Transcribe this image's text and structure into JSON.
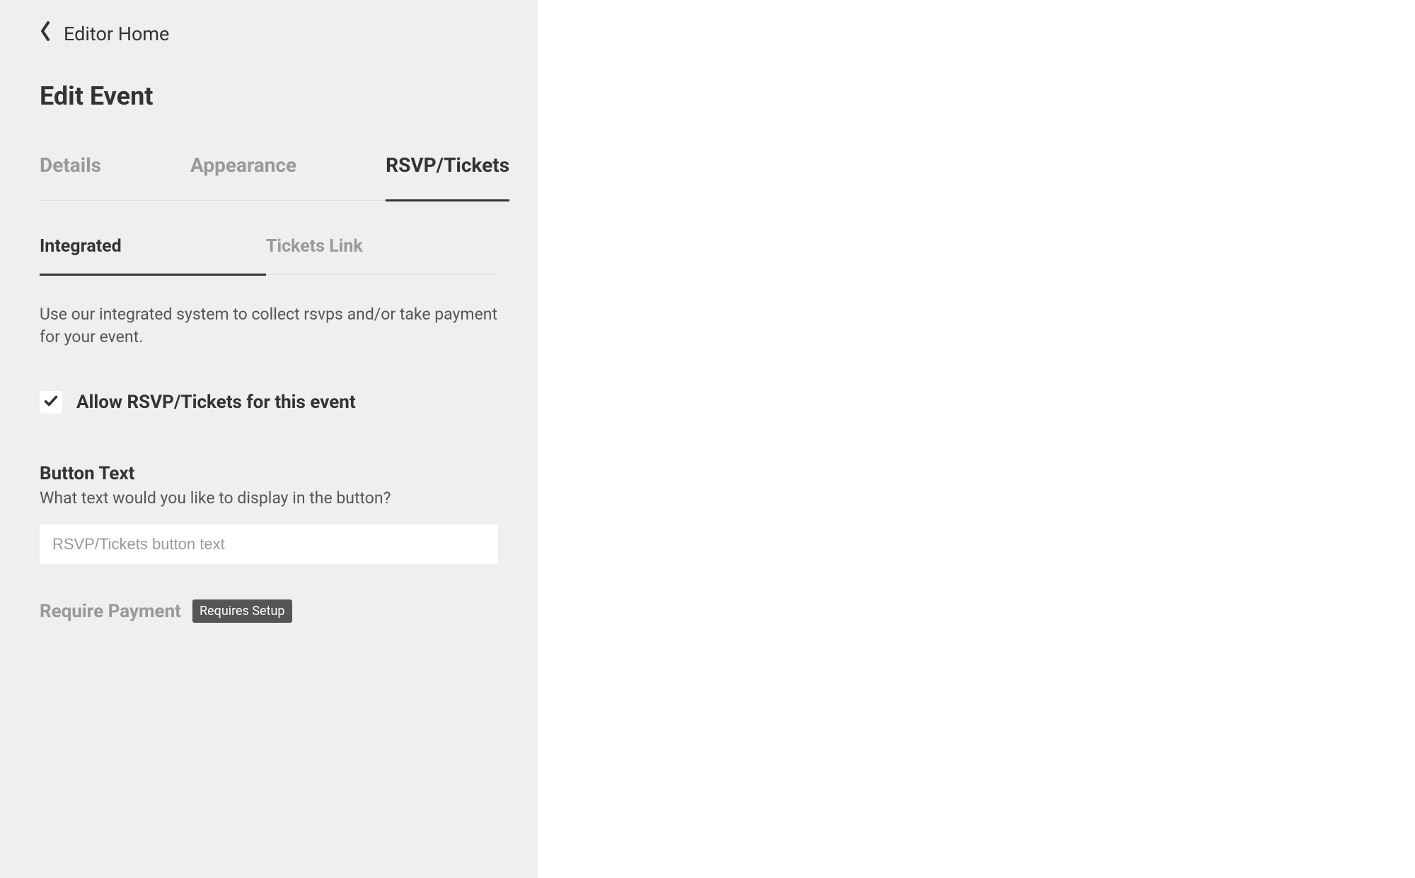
{
  "breadcrumb": {
    "label": "Editor Home"
  },
  "page": {
    "title": "Edit Event"
  },
  "mainTabs": {
    "details": "Details",
    "appearance": "Appearance",
    "rsvp": "RSVP/Tickets"
  },
  "subTabs": {
    "integrated": "Integrated",
    "ticketsLink": "Tickets Link"
  },
  "description": "Use our integrated system to collect rsvps and/or take payment for your event.",
  "allowRsvp": {
    "label": "Allow RSVP/Tickets for this event",
    "checked": true
  },
  "buttonText": {
    "title": "Button Text",
    "help": "What text would you like to display in the button?",
    "placeholder": "RSVP/Tickets button text",
    "value": ""
  },
  "requirePayment": {
    "title": "Require Payment",
    "badge": "Requires Setup"
  }
}
